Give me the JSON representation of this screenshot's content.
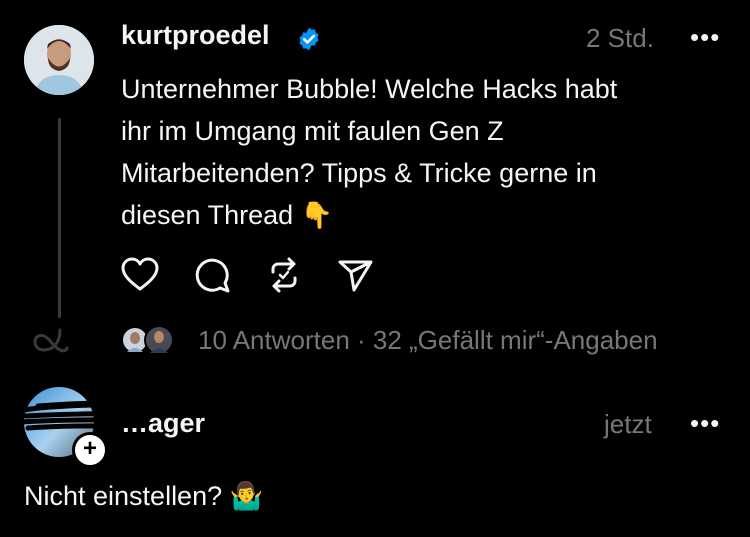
{
  "post": {
    "username": "kurtproedel",
    "verified": true,
    "time": "2 Std.",
    "more": "•••",
    "text_lines": [
      "Unternehmer Bubble! Welche Hacks habt",
      "ihr im Umgang mit faulen Gen Z",
      "Mitarbeitenden? Tipps & Tricke gerne in",
      "diesen Thread"
    ],
    "emoji": "👇",
    "actions": [
      "heart-icon",
      "comment-icon",
      "repost-icon",
      "share-icon"
    ],
    "stats": "10 Antworten · 32 „Gefällt mir“-Angaben"
  },
  "reply": {
    "username": "…ager",
    "time": "jetzt",
    "more": "•••",
    "text": "Nicht einstellen?",
    "emoji": "🤷‍♂️",
    "follow_symbol": "+"
  },
  "colors": {
    "background": "#000000",
    "text": "#f3f5f7",
    "muted": "#777777",
    "verified": "#0095f6"
  }
}
